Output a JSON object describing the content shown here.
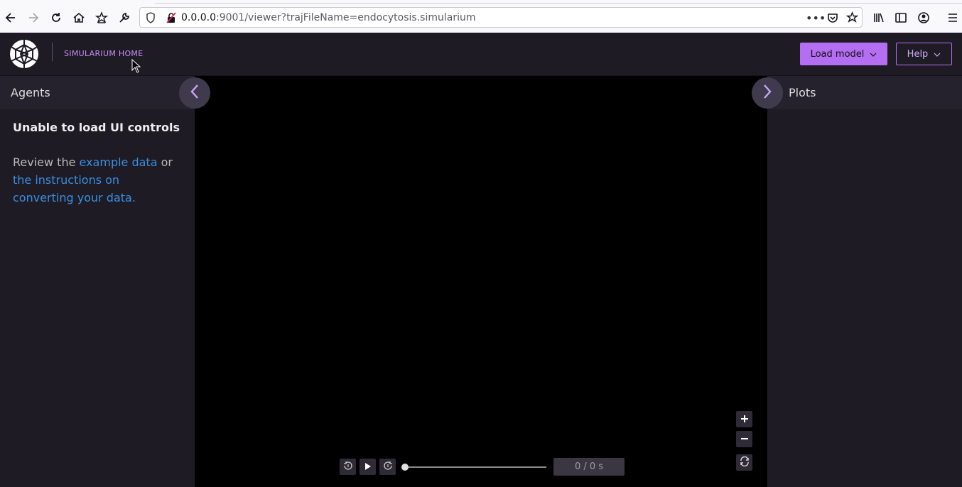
{
  "browser": {
    "url_host": "0.0.0.0",
    "url_rest": ":9001/viewer?trajFileName=endocytosis.simularium"
  },
  "header": {
    "home_label": "SIMULARIUM HOME",
    "load_label": "Load model",
    "help_label": "Help"
  },
  "left_panel": {
    "title": "Agents",
    "error_title": "Unable to load UI controls",
    "review_prefix": "Review the ",
    "example_link": "example data",
    "or_text": " or ",
    "instructions_link": "the instructions on converting your data."
  },
  "right_panel": {
    "title": "Plots"
  },
  "playback": {
    "time_text": "0 / 0 s"
  },
  "colors": {
    "accent": "#b46ef2",
    "link": "#3a8fe0",
    "panel_bg": "#1e1b25"
  }
}
